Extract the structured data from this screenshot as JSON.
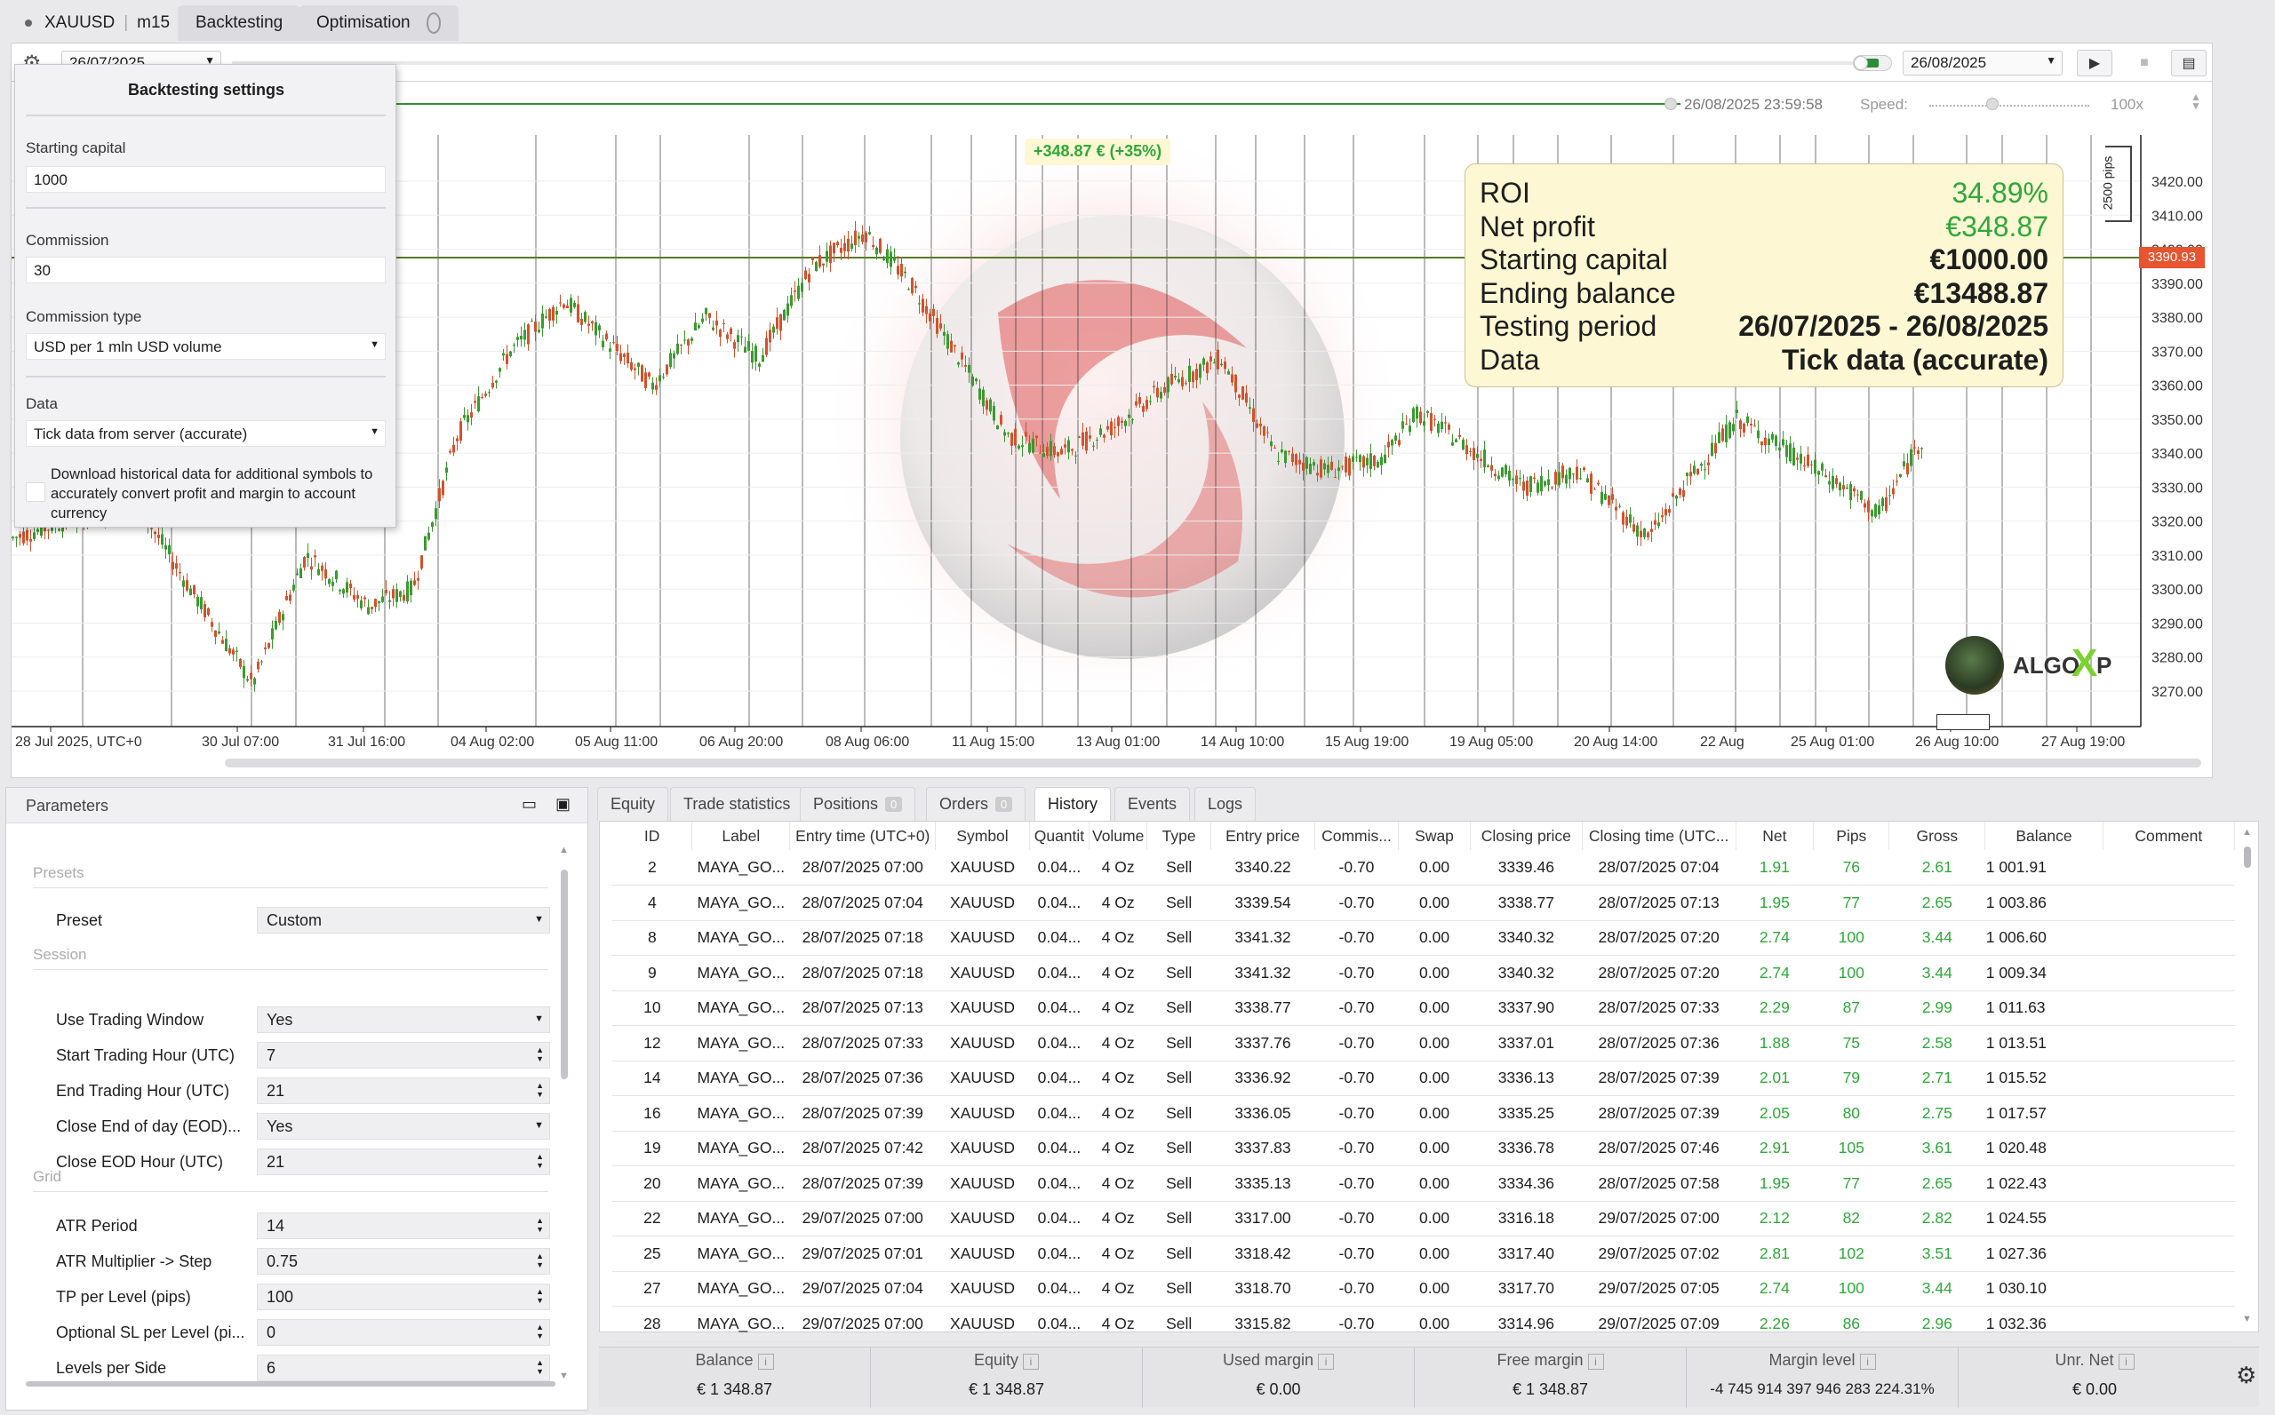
{
  "header": {
    "symbol": "XAUUSD",
    "timeframe": "m15",
    "tabs": [
      "Backtesting",
      "Optimisation"
    ]
  },
  "toolbar": {
    "start_date": "26/07/2025",
    "end_date": "26/08/2025",
    "current_time": "26/08/2025 23:59:58",
    "speed_label": "Speed:",
    "speed_value": "100x"
  },
  "settings": {
    "title": "Backtesting settings",
    "starting_capital_label": "Starting capital",
    "starting_capital": "1000",
    "commission_label": "Commission",
    "commission": "30",
    "commission_type_label": "Commission type",
    "commission_type": "USD per 1 mln USD volume",
    "data_label": "Data",
    "data": "Tick data from server (accurate)",
    "download_label": "Download historical data for additional symbols to accurately convert profit and margin to account currency"
  },
  "chart": {
    "profit_badge": "+348.87 € (+35%)",
    "current_price": "3390.93",
    "pips_label": "2500 pips",
    "price_ticks": [
      "3420.00",
      "3410.00",
      "3400.00",
      "3390.00",
      "3380.00",
      "3370.00",
      "3360.00",
      "3350.00",
      "3340.00",
      "3330.00",
      "3320.00",
      "3310.00",
      "3300.00",
      "3290.00",
      "3280.00",
      "3270.00"
    ],
    "time_ticks": [
      "28 Jul 2025, UTC+0",
      "30 Jul 07:00",
      "31 Jul 16:00",
      "04 Aug 02:00",
      "05 Aug 11:00",
      "06 Aug 20:00",
      "08 Aug 06:00",
      "11 Aug 15:00",
      "13 Aug 01:00",
      "14 Aug 10:00",
      "15 Aug 19:00",
      "19 Aug 05:00",
      "20 Aug 14:00",
      "22 Aug",
      "25 Aug 01:00",
      "26 Aug 10:00",
      "27 Aug 19:00"
    ],
    "brand_left": "ALGO",
    "brand_x": "X",
    "brand_right": "P"
  },
  "stats": {
    "roi_label": "ROI",
    "roi": "34.89%",
    "net_profit_label": "Net profit",
    "net_profit": "€348.87",
    "starting_capital_label": "Starting capital",
    "starting_capital": "€1000.00",
    "ending_balance_label": "Ending balance",
    "ending_balance": "€13488.87",
    "testing_period_label": "Testing period",
    "testing_period": "26/07/2025 - 26/08/2025",
    "data_label": "Data",
    "data": "Tick data (accurate)"
  },
  "parameters": {
    "title": "Parameters",
    "sections": {
      "presets": "Presets",
      "session": "Session",
      "grid": "Grid"
    },
    "rows": [
      {
        "label": "Preset",
        "value": "Custom"
      },
      {
        "label": "Use Trading Window",
        "value": "Yes"
      },
      {
        "label": "Start Trading Hour (UTC)",
        "value": "7"
      },
      {
        "label": "End Trading Hour (UTC)",
        "value": "21"
      },
      {
        "label": "Close End of day (EOD)...",
        "value": "Yes"
      },
      {
        "label": "Close EOD Hour (UTC)",
        "value": "21"
      },
      {
        "label": "ATR Period",
        "value": "14"
      },
      {
        "label": "ATR Multiplier -> Step",
        "value": "0.75"
      },
      {
        "label": "TP per Level (pips)",
        "value": "100"
      },
      {
        "label": "Optional SL per Level (pi...",
        "value": "0"
      },
      {
        "label": "Levels per Side",
        "value": "6"
      }
    ]
  },
  "bottom_tabs": {
    "equity": "Equity",
    "trade_statistics": "Trade statistics",
    "positions": "Positions",
    "positions_count": "0",
    "orders": "Orders",
    "orders_count": "0",
    "history": "History",
    "events": "Events",
    "logs": "Logs"
  },
  "history": {
    "columns": [
      "ID",
      "Label",
      "Entry time (UTC+0)",
      "Symbol",
      "Quantit",
      "Volume",
      "Type",
      "Entry price",
      "Commis...",
      "Swap",
      "Closing price",
      "Closing time (UTC...",
      "Net",
      "Pips",
      "Gross",
      "Balance",
      "Comment"
    ],
    "rows": [
      [
        "2",
        "MAYA_GO...",
        "28/07/2025 07:00",
        "XAUUSD",
        "0.04...",
        "4 Oz",
        "Sell",
        "3340.22",
        "-0.70",
        "0.00",
        "3339.46",
        "28/07/2025 07:04",
        "1.91",
        "76",
        "2.61",
        "1 001.91",
        ""
      ],
      [
        "4",
        "MAYA_GO...",
        "28/07/2025 07:04",
        "XAUUSD",
        "0.04...",
        "4 Oz",
        "Sell",
        "3339.54",
        "-0.70",
        "0.00",
        "3338.77",
        "28/07/2025 07:13",
        "1.95",
        "77",
        "2.65",
        "1 003.86",
        ""
      ],
      [
        "8",
        "MAYA_GO...",
        "28/07/2025 07:18",
        "XAUUSD",
        "0.04...",
        "4 Oz",
        "Sell",
        "3341.32",
        "-0.70",
        "0.00",
        "3340.32",
        "28/07/2025 07:20",
        "2.74",
        "100",
        "3.44",
        "1 006.60",
        ""
      ],
      [
        "9",
        "MAYA_GO...",
        "28/07/2025 07:18",
        "XAUUSD",
        "0.04...",
        "4 Oz",
        "Sell",
        "3341.32",
        "-0.70",
        "0.00",
        "3340.32",
        "28/07/2025 07:20",
        "2.74",
        "100",
        "3.44",
        "1 009.34",
        ""
      ],
      [
        "10",
        "MAYA_GO...",
        "28/07/2025 07:13",
        "XAUUSD",
        "0.04...",
        "4 Oz",
        "Sell",
        "3338.77",
        "-0.70",
        "0.00",
        "3337.90",
        "28/07/2025 07:33",
        "2.29",
        "87",
        "2.99",
        "1 011.63",
        ""
      ],
      [
        "12",
        "MAYA_GO...",
        "28/07/2025 07:33",
        "XAUUSD",
        "0.04...",
        "4 Oz",
        "Sell",
        "3337.76",
        "-0.70",
        "0.00",
        "3337.01",
        "28/07/2025 07:36",
        "1.88",
        "75",
        "2.58",
        "1 013.51",
        ""
      ],
      [
        "14",
        "MAYA_GO...",
        "28/07/2025 07:36",
        "XAUUSD",
        "0.04...",
        "4 Oz",
        "Sell",
        "3336.92",
        "-0.70",
        "0.00",
        "3336.13",
        "28/07/2025 07:39",
        "2.01",
        "79",
        "2.71",
        "1 015.52",
        ""
      ],
      [
        "16",
        "MAYA_GO...",
        "28/07/2025 07:39",
        "XAUUSD",
        "0.04...",
        "4 Oz",
        "Sell",
        "3336.05",
        "-0.70",
        "0.00",
        "3335.25",
        "28/07/2025 07:39",
        "2.05",
        "80",
        "2.75",
        "1 017.57",
        ""
      ],
      [
        "19",
        "MAYA_GO...",
        "28/07/2025 07:42",
        "XAUUSD",
        "0.04...",
        "4 Oz",
        "Sell",
        "3337.83",
        "-0.70",
        "0.00",
        "3336.78",
        "28/07/2025 07:46",
        "2.91",
        "105",
        "3.61",
        "1 020.48",
        ""
      ],
      [
        "20",
        "MAYA_GO...",
        "28/07/2025 07:39",
        "XAUUSD",
        "0.04...",
        "4 Oz",
        "Sell",
        "3335.13",
        "-0.70",
        "0.00",
        "3334.36",
        "28/07/2025 07:58",
        "1.95",
        "77",
        "2.65",
        "1 022.43",
        ""
      ],
      [
        "22",
        "MAYA_GO...",
        "29/07/2025 07:00",
        "XAUUSD",
        "0.04...",
        "4 Oz",
        "Sell",
        "3317.00",
        "-0.70",
        "0.00",
        "3316.18",
        "29/07/2025 07:00",
        "2.12",
        "82",
        "2.82",
        "1 024.55",
        ""
      ],
      [
        "25",
        "MAYA_GO...",
        "29/07/2025 07:01",
        "XAUUSD",
        "0.04...",
        "4 Oz",
        "Sell",
        "3318.42",
        "-0.70",
        "0.00",
        "3317.40",
        "29/07/2025 07:02",
        "2.81",
        "102",
        "3.51",
        "1 027.36",
        ""
      ],
      [
        "27",
        "MAYA_GO...",
        "29/07/2025 07:04",
        "XAUUSD",
        "0.04...",
        "4 Oz",
        "Sell",
        "3318.70",
        "-0.70",
        "0.00",
        "3317.70",
        "29/07/2025 07:05",
        "2.74",
        "100",
        "3.44",
        "1 030.10",
        ""
      ],
      [
        "28",
        "MAYA_GO...",
        "29/07/2025 07:00",
        "XAUUSD",
        "0.04...",
        "4 Oz",
        "Sell",
        "3315.82",
        "-0.70",
        "0.00",
        "3314.96",
        "29/07/2025 07:09",
        "2.26",
        "86",
        "2.96",
        "1 032.36",
        ""
      ]
    ]
  },
  "account": {
    "balance_label": "Balance",
    "balance": "€ 1 348.87",
    "equity_label": "Equity",
    "equity": "€ 1 348.87",
    "used_margin_label": "Used margin",
    "used_margin": "€ 0.00",
    "free_margin_label": "Free margin",
    "free_margin": "€ 1 348.87",
    "margin_level_label": "Margin level",
    "margin_level": "-4 745 914 397 946 283 224.31%",
    "unr_net_label": "Unr. Net",
    "unr_net": "€ 0.00"
  },
  "colors": {
    "profit_green": "#2ea83a",
    "candle_green": "#3a9a2f",
    "candle_red": "#d2522b",
    "price_badge": "#e8542f",
    "accent_blue": "#3a7bd5"
  }
}
